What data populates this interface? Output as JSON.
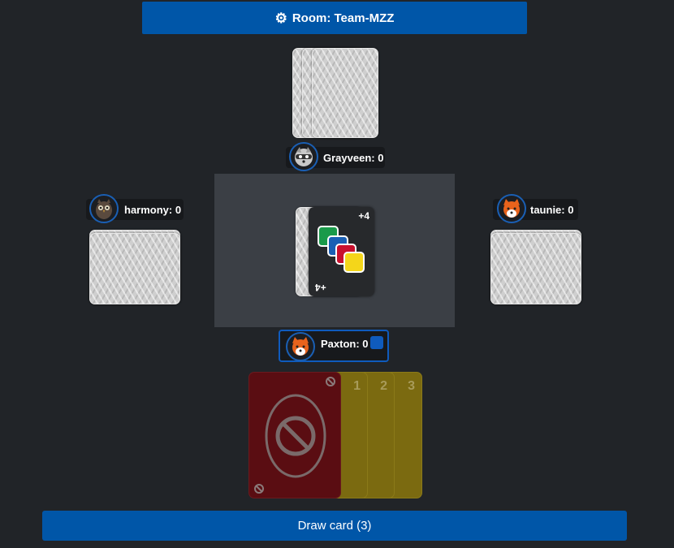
{
  "header": {
    "room_label": "Room: Team-MZZ",
    "icon": "gear-icon"
  },
  "players": {
    "top": {
      "name_score": "Grayveen: 0",
      "avatar": "raccoon"
    },
    "left": {
      "name_score": "harmony: 0",
      "avatar": "owl"
    },
    "right": {
      "name_score": "taunie: 0",
      "avatar": "fox"
    },
    "self": {
      "name_score": "Paxton: 0",
      "avatar": "fox",
      "color_indicator": "#0f5bbd"
    }
  },
  "discard": {
    "top_corner": "+4",
    "bottom_corner": "+4",
    "colors": [
      "#1a9a4a",
      "#1a5fb4",
      "#c8102e",
      "#f4d61a"
    ]
  },
  "hand": [
    {
      "color": "red",
      "symbol": "skip"
    },
    {
      "color": "yellow",
      "number": "1"
    },
    {
      "color": "yellow",
      "number": "2"
    },
    {
      "color": "yellow",
      "number": "3"
    }
  ],
  "actions": {
    "draw_label": "Draw card (3)"
  }
}
